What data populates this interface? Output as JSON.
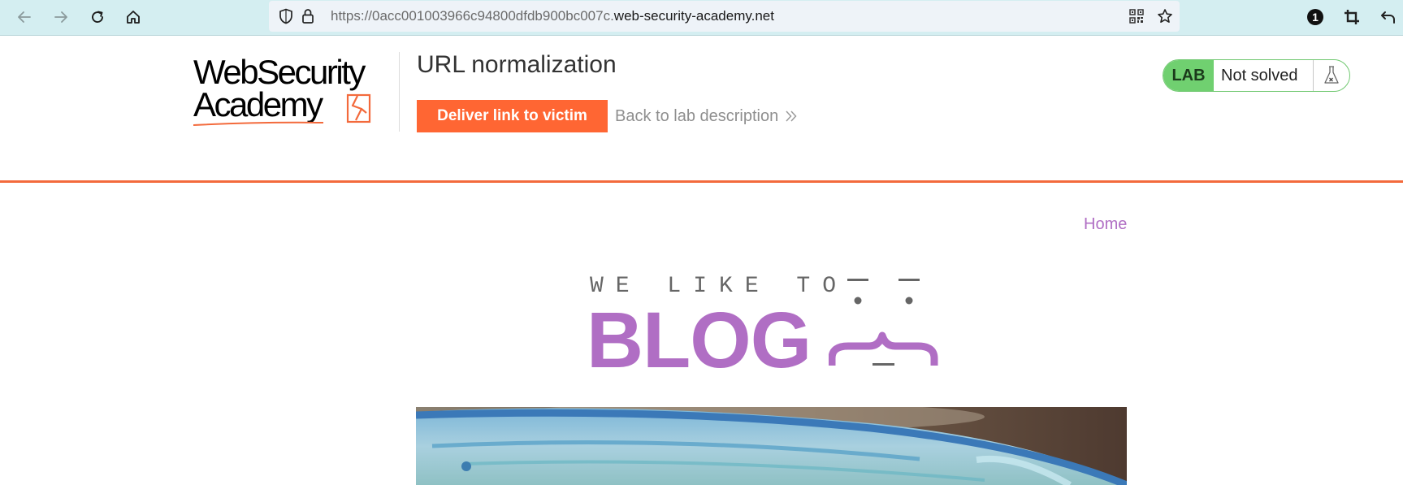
{
  "browser": {
    "url_prefix": "https://0acc001003966c94800dfdb900bc007c.",
    "url_domain": "web-security-academy.net",
    "extension_badge": "1"
  },
  "lab_header": {
    "logo_line1": "WebSecurity",
    "logo_line2": "Academy",
    "title": "URL normalization",
    "deliver_button": "Deliver link to victim",
    "back_link": "Back to lab description",
    "lab_badge": "LAB",
    "status": "Not solved"
  },
  "blog": {
    "nav_home": "Home",
    "tagline": "WE LIKE TO",
    "logo_word": "BLOG"
  },
  "colors": {
    "accent": "#ff6633",
    "purple": "#b06ec4",
    "lab_green": "#70d070",
    "browser_bar": "#d4eef1"
  }
}
